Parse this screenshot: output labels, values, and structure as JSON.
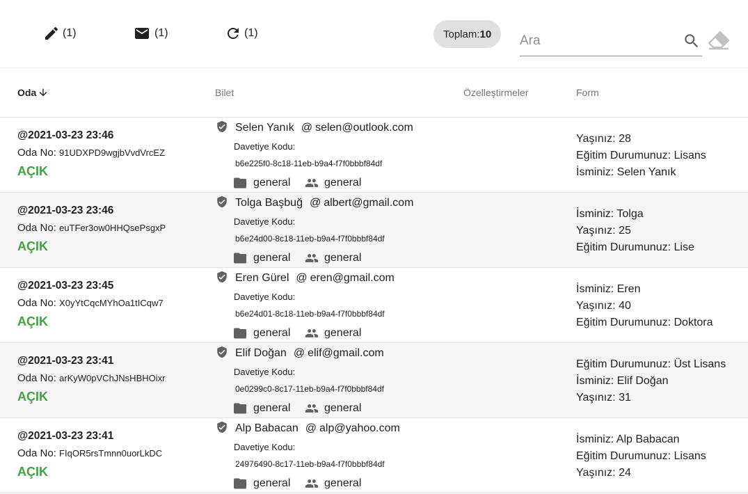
{
  "toolbar": {
    "edit_count": "(1)",
    "mail_count": "(1)",
    "refresh_count": "(1)",
    "total_label": "Toplam:",
    "total_value": "10",
    "search_placeholder": "Ara"
  },
  "headers": {
    "oda": "Oda",
    "bilet": "Bilet",
    "ozel": "Özelleştirmeler",
    "form": "Form"
  },
  "room_label": "Oda No:",
  "invite_label": "Davetiye Kodu:",
  "rows": [
    {
      "date": "@2021-03-23 23:46",
      "room_code": "91UDXPD9wgjbVvdVrcEZ",
      "status": "AÇIK",
      "name": "Selen Yanık",
      "at": "@",
      "email": "selen@outlook.com",
      "invite_code": "b6e225f0-8c18-11eb-b9a4-f7f0bbbf84df",
      "folder": "general",
      "group": "general",
      "form": [
        "Yaşınız: 28",
        "Eğitim Durumunuz: Lisans",
        "İsminiz: Selen Yanık"
      ]
    },
    {
      "date": "@2021-03-23 23:46",
      "room_code": "euTFer3ow0HHQsePsgxP",
      "status": "AÇIK",
      "name": "Tolga Başbuğ",
      "at": "@",
      "email": "albert@gmail.com",
      "invite_code": "b6e24d00-8c18-11eb-b9a4-f7f0bbbf84df",
      "folder": "general",
      "group": "general",
      "form": [
        "İsminiz: Tolga",
        "Yaşınız: 25",
        "Eğitim Durumunuz: Lise"
      ]
    },
    {
      "date": "@2021-03-23 23:45",
      "room_code": "X0yYtCqcMYhOa1tICqw7",
      "status": "AÇIK",
      "name": "Eren Gürel",
      "at": "@",
      "email": "eren@gmail.com",
      "invite_code": "b6e24d01-8c18-11eb-b9a4-f7f0bbbf84df",
      "folder": "general",
      "group": "general",
      "form": [
        "İsminiz: Eren",
        "Yaşınız: 40",
        "Eğitim Durumunuz: Doktora"
      ]
    },
    {
      "date": "@2021-03-23 23:41",
      "room_code": "arKyW0pVChJNsHBHOixr",
      "status": "AÇIK",
      "name": "Elif Doğan",
      "at": "@",
      "email": "elif@gmail.com",
      "invite_code": "0e0299c0-8c17-11eb-b9a4-f7f0bbbf84df",
      "folder": "general",
      "group": "general",
      "form": [
        "Eğitim Durumunuz: Üst Lisans",
        "İsminiz: Elif Doğan",
        "Yaşınız: 31"
      ]
    },
    {
      "date": "@2021-03-23 23:41",
      "room_code": "FIqOR5rsTmnn0uorLkDC",
      "status": "AÇIK",
      "name": "Alp Babacan",
      "at": "@",
      "email": "alp@yahoo.com",
      "invite_code": "24976490-8c17-11eb-b9a4-f7f0bbbf84df",
      "folder": "general",
      "group": "general",
      "form": [
        "İsminiz: Alp Babacan",
        "Eğitim Durumunuz: Lisans",
        "Yaşınız: 24"
      ]
    }
  ],
  "colors": {
    "status_open": "#43a047",
    "chip_bg": "#e0e0e0",
    "alt_row": "#f5f5f5"
  },
  "icons": [
    "pencil-icon",
    "mail-icon",
    "refresh-icon",
    "search-icon",
    "eraser-icon",
    "arrow-down-icon",
    "shield-check-icon",
    "folder-icon",
    "people-icon"
  ]
}
